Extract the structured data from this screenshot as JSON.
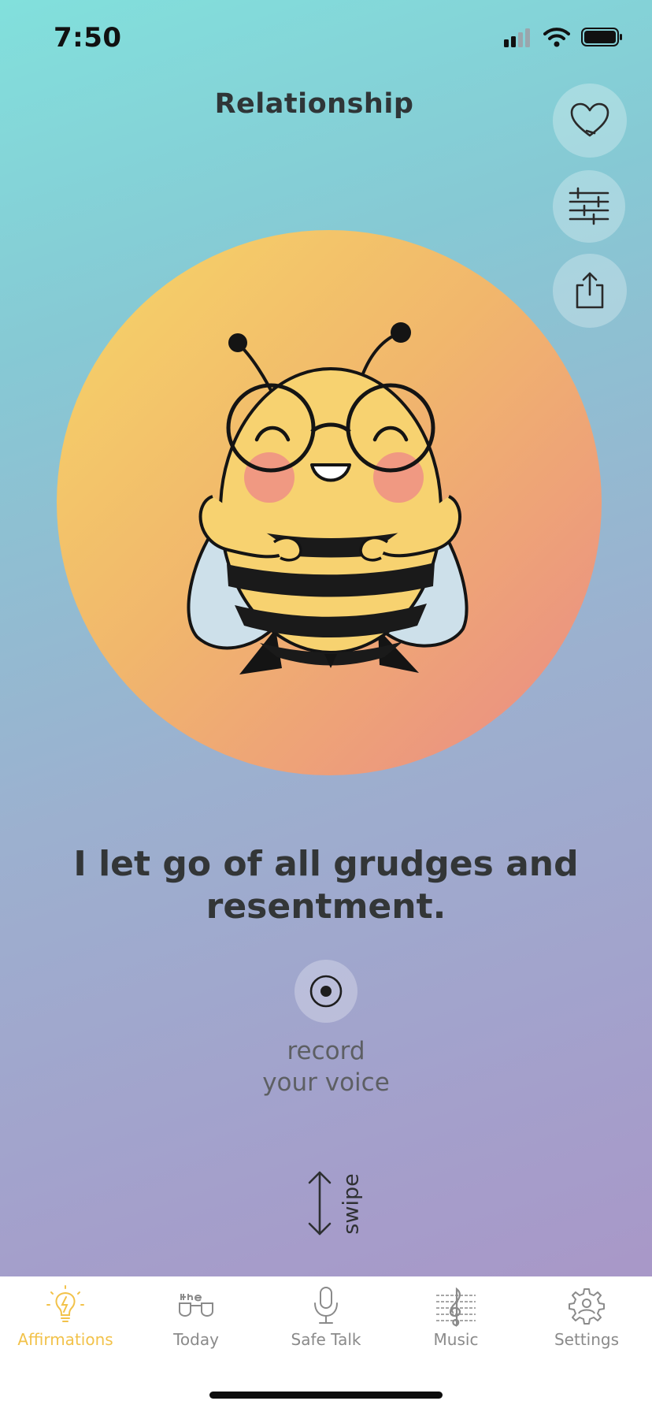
{
  "status_bar": {
    "time": "7:50"
  },
  "header": {
    "title": "Relationship"
  },
  "actions": {
    "favorite": "heart-icon",
    "customize": "sliders-icon",
    "share": "share-icon"
  },
  "affirmation": {
    "text": "I let go of all grudges and resentment."
  },
  "record": {
    "line1": "record",
    "line2": "your voice"
  },
  "swipe": {
    "label": "swipe"
  },
  "tabs": [
    {
      "label": "Affirmations",
      "icon": "lightbulb-icon",
      "active": true
    },
    {
      "label": "Today",
      "icon": "glasses-icon",
      "active": false
    },
    {
      "label": "Safe Talk",
      "icon": "microphone-icon",
      "active": false
    },
    {
      "label": "Music",
      "icon": "music-icon",
      "active": false
    },
    {
      "label": "Settings",
      "icon": "gear-icon",
      "active": false
    }
  ],
  "colors": {
    "accent_active": "#f2c24a",
    "tab_inactive": "#8a8a8a",
    "circle_gradient": [
      "#f6d667",
      "#f1b76c",
      "#ea8a86"
    ],
    "background_gradient": [
      "#82e0dc",
      "#9cb0cf",
      "#ab93c6"
    ]
  }
}
